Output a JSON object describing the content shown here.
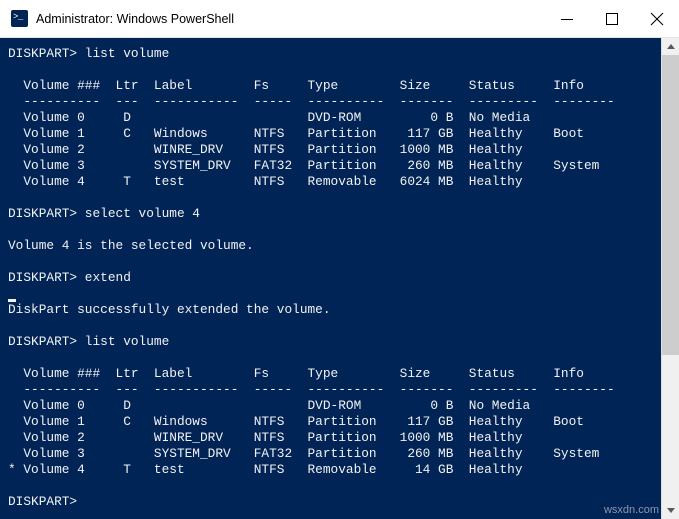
{
  "window": {
    "title": "Administrator: Windows PowerShell",
    "icon": "powershell-icon",
    "prompt_glyph": ">_",
    "minimize_label": "Minimize",
    "maximize_label": "Maximize",
    "close_label": "Close",
    "background_color": "#012456",
    "titlebar_color": "#ffffff",
    "text_color": "#f2f2f2"
  },
  "scrollbar": {
    "up_arrow": "scroll-up",
    "down_arrow": "scroll-down",
    "thumb": "scroll-thumb"
  },
  "watermark": "wsxdn.com",
  "console": {
    "lines": [
      "DISKPART> list volume",
      "",
      "  Volume ###  Ltr  Label        Fs     Type        Size     Status     Info",
      "  ----------  ---  -----------  -----  ----------  -------  ---------  --------",
      "  Volume 0     D                       DVD-ROM         0 B  No Media",
      "  Volume 1     C   Windows      NTFS   Partition    117 GB  Healthy    Boot",
      "  Volume 2         WINRE_DRV    NTFS   Partition   1000 MB  Healthy",
      "  Volume 3         SYSTEM_DRV   FAT32  Partition    260 MB  Healthy    System",
      "  Volume 4     T   test         NTFS   Removable   6024 MB  Healthy",
      "",
      "DISKPART> select volume 4",
      "",
      "Volume 4 is the selected volume.",
      "",
      "DISKPART> extend",
      "",
      "DiskPart successfully extended the volume.",
      "",
      "DISKPART> list volume",
      "",
      "  Volume ###  Ltr  Label        Fs     Type        Size     Status     Info",
      "  ----------  ---  -----------  -----  ----------  -------  ---------  --------",
      "  Volume 0     D                       DVD-ROM         0 B  No Media",
      "  Volume 1     C   Windows      NTFS   Partition    117 GB  Healthy    Boot",
      "  Volume 2         WINRE_DRV    NTFS   Partition   1000 MB  Healthy",
      "  Volume 3         SYSTEM_DRV   FAT32  Partition    260 MB  Healthy    System",
      "* Volume 4     T   test         NTFS   Removable     14 GB  Healthy",
      "",
      "DISKPART>"
    ]
  }
}
